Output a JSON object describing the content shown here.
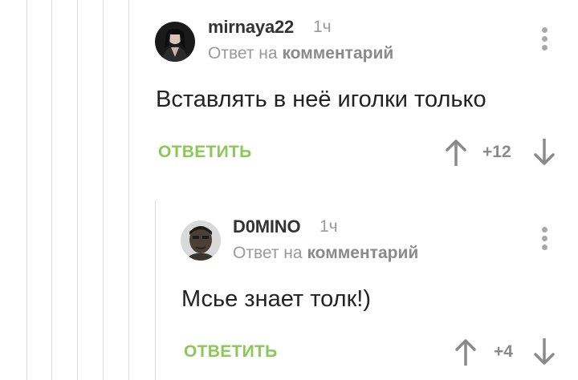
{
  "comments": [
    {
      "username": "mirnaya22",
      "time": "1ч",
      "reply_prefix": "Ответ на",
      "reply_target": "комментарий",
      "text": "Вставлять в неё иголки только",
      "reply_label": "ОТВЕТИТЬ",
      "score": "+12"
    },
    {
      "username": "D0MINO",
      "time": "1ч",
      "reply_prefix": "Ответ на",
      "reply_target": "комментарий",
      "text": "Мсье знает толк!)",
      "reply_label": "ОТВЕТИТЬ",
      "score": "+4"
    }
  ],
  "colors": {
    "accent_green": "#8ac858",
    "muted_gray": "#9a9a9a",
    "thread_line": "#dcdcdc"
  },
  "icons": [
    "upvote-arrow-icon",
    "downvote-arrow-icon",
    "more-options-icon"
  ]
}
